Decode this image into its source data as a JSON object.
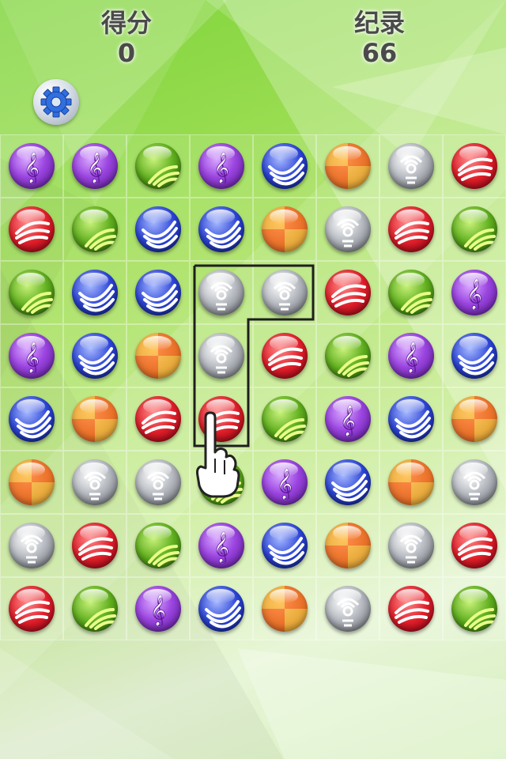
{
  "hud": {
    "score_label": "得分",
    "score_value": "0",
    "record_label": "纪录",
    "record_value": "66"
  },
  "settings_icon": "gear-icon",
  "colors": {
    "purple": "#9b45e0",
    "red": "#e01f2a",
    "green": "#5fae1e",
    "blue": "#2c45d6",
    "orange": "#ff8a1a",
    "silver": "#b8bcc2"
  },
  "board": {
    "rows": 8,
    "cols": 8,
    "cells": [
      [
        "purple",
        "purple",
        "green",
        "purple",
        "blue",
        "orange",
        "silver",
        "red"
      ],
      [
        "red",
        "green",
        "blue",
        "blue",
        "orange",
        "silver",
        "red",
        "green"
      ],
      [
        "green",
        "blue",
        "blue",
        "silver",
        "silver",
        "red",
        "green",
        "purple"
      ],
      [
        "purple",
        "blue",
        "orange",
        "silver",
        "red",
        "green",
        "purple",
        "blue"
      ],
      [
        "blue",
        "orange",
        "red",
        "red",
        "green",
        "purple",
        "blue",
        "orange"
      ],
      [
        "orange",
        "silver",
        "silver",
        "green",
        "purple",
        "blue",
        "orange",
        "silver"
      ],
      [
        "silver",
        "red",
        "green",
        "purple",
        "blue",
        "orange",
        "silver",
        "red"
      ],
      [
        "red",
        "green",
        "purple",
        "blue",
        "orange",
        "silver",
        "red",
        "green"
      ]
    ]
  },
  "hint": {
    "highlighted_cells": [
      [
        2,
        3
      ],
      [
        2,
        4
      ],
      [
        3,
        3
      ],
      [
        4,
        3
      ]
    ],
    "pointer_icon": "hand-pointer-icon"
  }
}
